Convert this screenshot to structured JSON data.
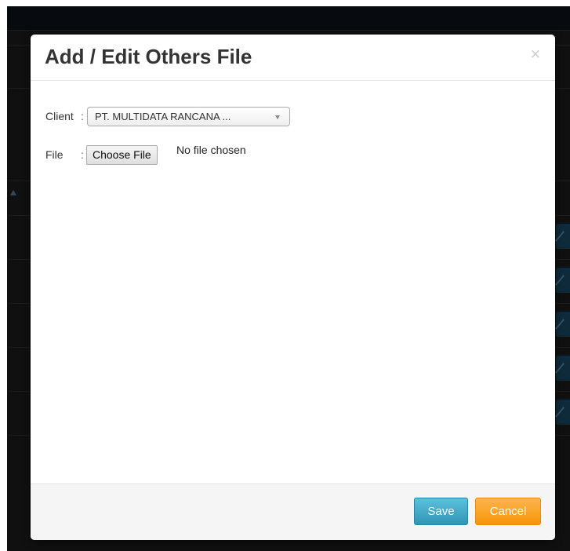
{
  "dialog": {
    "title": "Add / Edit Others File",
    "close_symbol": "×"
  },
  "form": {
    "client_label": "Client",
    "client_colon": ":",
    "client_selected": "PT. MULTIDATA RANCANA ...",
    "file_label": "File",
    "file_colon": ":",
    "file_button_label": "Choose File",
    "file_status": "No file chosen"
  },
  "footer": {
    "save_label": "Save",
    "cancel_label": "Cancel"
  },
  "colors": {
    "save": "#5bc0de",
    "cancel": "#f89406",
    "title": "#333333"
  },
  "icons": [
    "close-icon",
    "dropdown-arrow-icon",
    "sort-ascending-icon",
    "edit-icon"
  ]
}
